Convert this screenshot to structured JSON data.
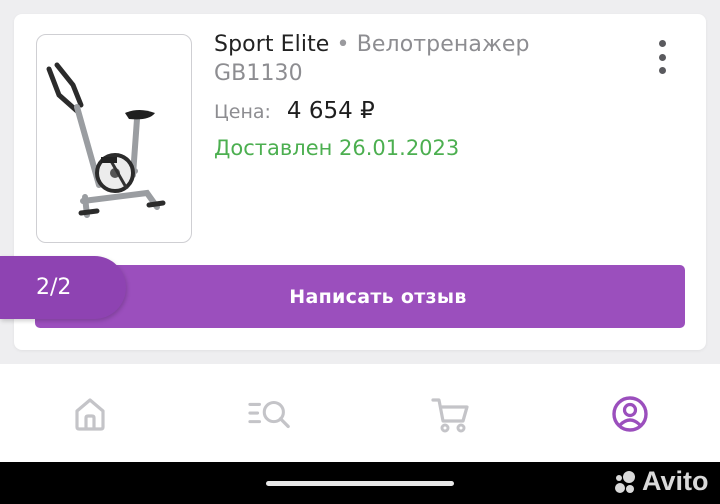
{
  "order_card": {
    "product_brand": "Sport Elite",
    "separator": "•",
    "product_name_line1": "Велотренажер",
    "product_name_line2": "GB1130",
    "price_label": "Цена:",
    "price_value": "4 654 ₽",
    "status_text": "Доставлен 26.01.2023",
    "review_button_label": "Написать отзыв",
    "pager_text": "2/2",
    "menu_icon": "kebab-menu-icon"
  },
  "bottom_nav": {
    "items": [
      {
        "name": "home",
        "icon": "home-icon",
        "active": false
      },
      {
        "name": "search",
        "icon": "search-catalog-icon",
        "active": false
      },
      {
        "name": "cart",
        "icon": "cart-icon",
        "active": false
      },
      {
        "name": "profile",
        "icon": "profile-icon",
        "active": true
      }
    ]
  },
  "watermark": {
    "text": "Avito"
  },
  "colors": {
    "accent_purple": "#9b4fbd",
    "pager_purple": "#8e43b2",
    "status_green": "#4caf50",
    "nav_inactive": "#c4c4c8",
    "nav_active": "#9b4fbd"
  }
}
